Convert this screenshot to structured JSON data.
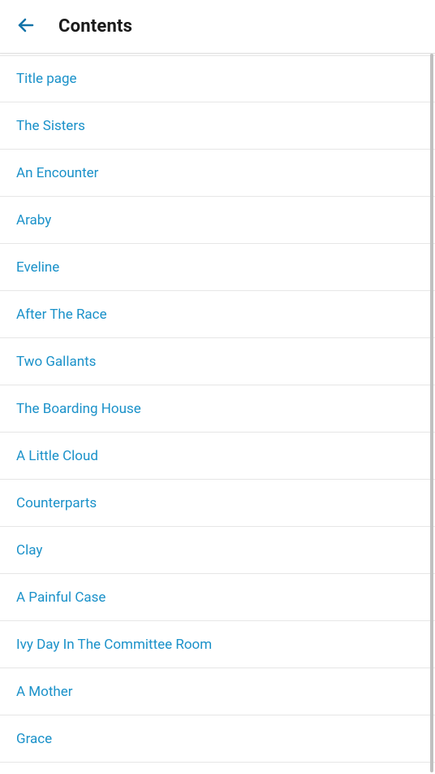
{
  "header": {
    "title": "Contents"
  },
  "colors": {
    "link": "#1A91C9",
    "backIcon": "#1273A8"
  },
  "toc": {
    "items": [
      {
        "label": "Title page"
      },
      {
        "label": "The Sisters"
      },
      {
        "label": "An Encounter"
      },
      {
        "label": "Araby"
      },
      {
        "label": "Eveline"
      },
      {
        "label": "After The Race"
      },
      {
        "label": "Two Gallants"
      },
      {
        "label": "The Boarding House"
      },
      {
        "label": "A Little Cloud"
      },
      {
        "label": "Counterparts"
      },
      {
        "label": "Clay"
      },
      {
        "label": "A Painful Case"
      },
      {
        "label": "Ivy Day In The Committee Room"
      },
      {
        "label": "A Mother"
      },
      {
        "label": "Grace"
      }
    ]
  }
}
